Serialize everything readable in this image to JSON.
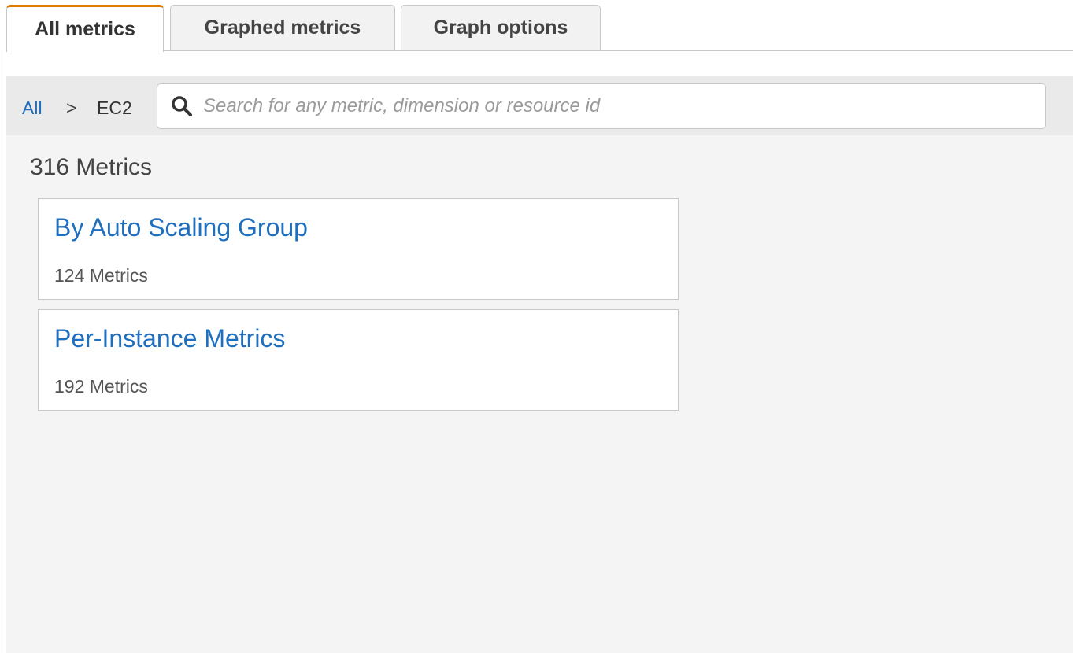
{
  "tabs": [
    {
      "label": "All metrics",
      "active": true
    },
    {
      "label": "Graphed metrics",
      "active": false
    },
    {
      "label": "Graph options",
      "active": false
    }
  ],
  "breadcrumb": {
    "root": "All",
    "separator": ">",
    "current": "EC2"
  },
  "search": {
    "placeholder": "Search for any metric, dimension or resource id",
    "value": ""
  },
  "summary": {
    "total": "316 Metrics"
  },
  "categories": [
    {
      "title": "By Auto Scaling Group",
      "count": "124 Metrics"
    },
    {
      "title": "Per-Instance Metrics",
      "count": "192 Metrics"
    }
  ],
  "colors": {
    "accent_tab": "#e07b00",
    "link": "#1f6fc0",
    "panel_bg": "#f4f4f4"
  },
  "icons": {
    "search": "search-icon"
  }
}
